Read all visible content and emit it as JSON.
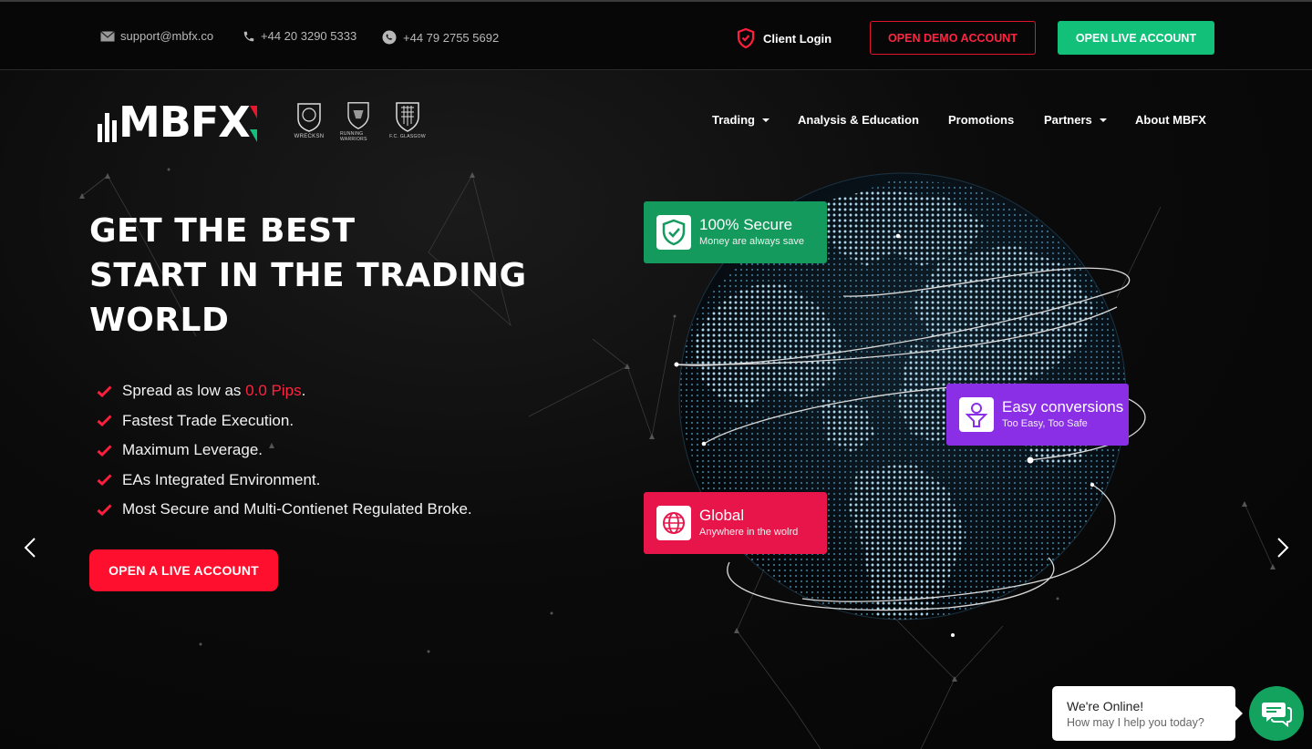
{
  "topbar": {
    "email": "support@mbfx.co",
    "phone": "+44 20 3290 5333",
    "whatsapp": "+44 79 2755 5692",
    "client_login": "Client Login",
    "demo_button": "OPEN DEMO ACCOUNT",
    "live_button": "OPEN LIVE ACCOUNT"
  },
  "brand": {
    "logo_text": "MBFX",
    "crests": [
      "WRECKSN",
      "RUNNING WARRIORS",
      "F.C. GLASGOW"
    ]
  },
  "nav": {
    "items": [
      {
        "label": "Trading",
        "dropdown": true
      },
      {
        "label": "Analysis & Education",
        "dropdown": false
      },
      {
        "label": "Promotions",
        "dropdown": false
      },
      {
        "label": "Partners",
        "dropdown": true
      },
      {
        "label": "About MBFX",
        "dropdown": false
      }
    ]
  },
  "hero": {
    "headline": [
      "GET THE BEST",
      "START IN THE TRADING",
      "WORLD"
    ],
    "features": {
      "spread_prefix": "Spread as low as ",
      "spread_highlight": "0.0 Pips",
      "spread_suffix": ".",
      "item2": "Fastest Trade Execution.",
      "item3": "Maximum Leverage.",
      "item4": "EAs Integrated Environment.",
      "item5": "Most Secure and Multi-Contienet Regulated Broke."
    },
    "cta": "OPEN A LIVE ACCOUNT"
  },
  "cards": {
    "secure": {
      "title": "100% Secure",
      "subtitle": "Money are always save"
    },
    "conversions": {
      "title": "Easy conversions",
      "subtitle": "Too Easy, Too Safe"
    },
    "global": {
      "title": "Global",
      "subtitle": "Anywhere in the wolrd"
    }
  },
  "chat": {
    "title": "We're Online!",
    "subtitle": "How may I help you today?"
  },
  "colors": {
    "accent_red": "#ff0f2e",
    "accent_green": "#12c07a",
    "card_green": "#149a5d",
    "card_purple": "#8b2fe6",
    "card_red": "#e8154a"
  }
}
